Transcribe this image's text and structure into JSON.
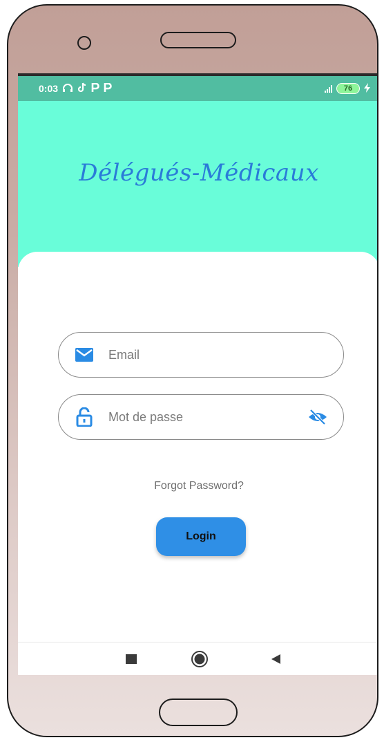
{
  "status_bar": {
    "time": "0:03",
    "notification_icons": [
      "headphones-icon",
      "tiktok-icon",
      "p-icon",
      "p-icon"
    ],
    "battery_level": "76",
    "charging": true
  },
  "app": {
    "title": "Délégués-Médicaux"
  },
  "form": {
    "email_placeholder": "Email",
    "email_value": "",
    "password_placeholder": "Mot de passe",
    "password_value": "",
    "forgot_label": "Forgot Password?",
    "login_label": "Login"
  },
  "colors": {
    "header_bg": "#69fdd9",
    "status_bar_bg": "#51bda1",
    "title_color": "#2a7bd8",
    "accent_blue": "#2f8fe6",
    "phone_frame": "#c19f97"
  },
  "nav": {
    "items": [
      "recents-square-icon",
      "home-circle-icon",
      "back-triangle-icon"
    ]
  }
}
